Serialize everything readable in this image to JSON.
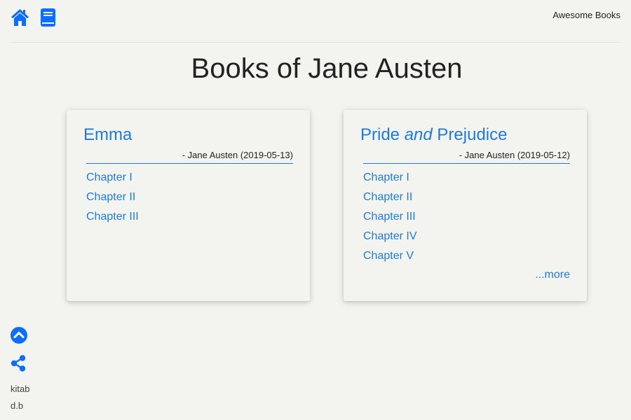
{
  "nav": {
    "home_icon": "home-icon",
    "book_icon": "book-icon",
    "brand": "Awesome Books"
  },
  "page": {
    "title": "Books of Jane Austen"
  },
  "books": [
    {
      "title": "Emma",
      "meta": "- Jane Austen (2019-05-13)",
      "chapters": [
        "Chapter I",
        "Chapter II",
        "Chapter III"
      ]
    },
    {
      "title_pre": "Pride ",
      "title_em": "and",
      "title_post": " Prejudice",
      "meta": "- Jane Austen (2019-05-12)",
      "chapters": [
        "Chapter I",
        "Chapter II",
        "Chapter III",
        "Chapter IV",
        "Chapter V"
      ],
      "more": "...more"
    }
  ],
  "side": {
    "up_icon": "chevron-up-circle-icon",
    "share_icon": "share-icon",
    "line1": "kitab",
    "line2": "d.b"
  },
  "colors": {
    "accent": "#1f7bd8",
    "icon": "#0d6efd",
    "background": "#f3f3ef"
  }
}
